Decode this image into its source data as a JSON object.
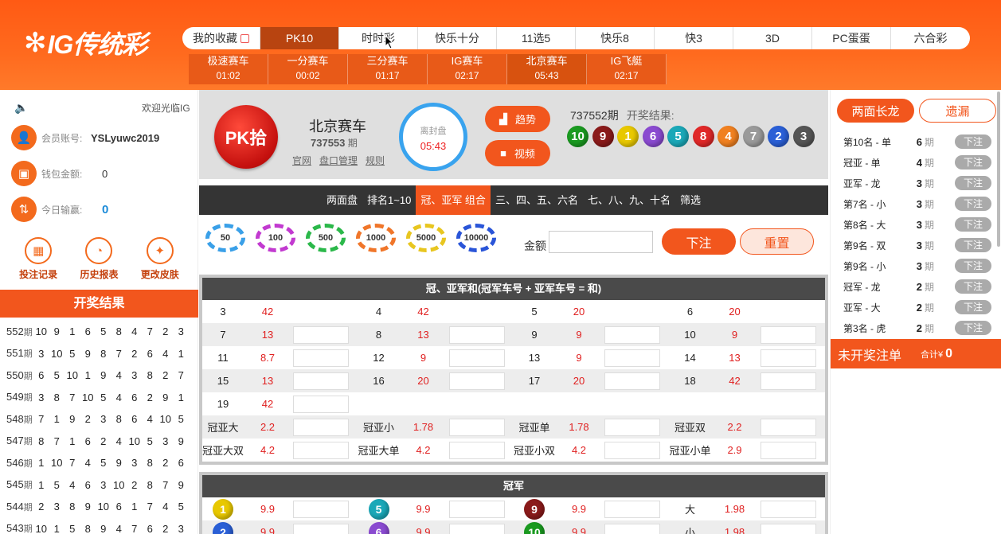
{
  "header": {
    "logo": "IG传统彩",
    "nav": [
      {
        "label": "我的收藏",
        "w": 98
      },
      {
        "label": "PK10",
        "w": 99
      },
      {
        "label": "时时彩",
        "w": 99
      },
      {
        "label": "快乐十分",
        "w": 99
      },
      {
        "label": "11选5",
        "w": 99
      },
      {
        "label": "快乐8",
        "w": 99
      },
      {
        "label": "快3",
        "w": 99
      },
      {
        "label": "3D",
        "w": 99
      },
      {
        "label": "PC蛋蛋",
        "w": 99
      },
      {
        "label": "六合彩",
        "w": 99
      }
    ],
    "active": 1,
    "subnav": [
      {
        "name": "极速赛车",
        "time": "01:02"
      },
      {
        "name": "一分赛车",
        "time": "00:02"
      },
      {
        "name": "三分赛车",
        "time": "01:17"
      },
      {
        "name": "IG赛车",
        "time": "02:17"
      },
      {
        "name": "北京赛车",
        "time": "05:43"
      },
      {
        "name": "IG飞艇",
        "time": "02:17"
      }
    ],
    "sub_active": 4
  },
  "user": {
    "welcome": "欢迎光临IG",
    "account_label": "会员账号:",
    "account": "YSLyuwc2019",
    "balance_label": "钱包金额:",
    "balance": "0",
    "profit_label": "今日输赢:",
    "profit": "0",
    "tools": [
      "投注记录",
      "历史报表",
      "更改皮肤"
    ]
  },
  "history": {
    "title": "开奖结果",
    "unit": "期",
    "rows": [
      {
        "p": "552",
        "n": [
          10,
          9,
          1,
          6,
          5,
          8,
          4,
          7,
          2,
          3
        ]
      },
      {
        "p": "551",
        "n": [
          3,
          10,
          5,
          9,
          8,
          7,
          2,
          6,
          4,
          1
        ]
      },
      {
        "p": "550",
        "n": [
          6,
          5,
          10,
          1,
          9,
          4,
          3,
          8,
          2,
          7
        ]
      },
      {
        "p": "549",
        "n": [
          3,
          8,
          7,
          10,
          5,
          4,
          6,
          2,
          9,
          1
        ]
      },
      {
        "p": "548",
        "n": [
          7,
          1,
          9,
          2,
          3,
          8,
          6,
          4,
          10,
          5
        ]
      },
      {
        "p": "547",
        "n": [
          8,
          7,
          1,
          6,
          2,
          4,
          10,
          5,
          3,
          9
        ]
      },
      {
        "p": "546",
        "n": [
          1,
          10,
          7,
          4,
          5,
          9,
          3,
          8,
          2,
          6
        ]
      },
      {
        "p": "545",
        "n": [
          1,
          5,
          4,
          6,
          3,
          10,
          2,
          8,
          7,
          9
        ]
      },
      {
        "p": "544",
        "n": [
          2,
          3,
          8,
          9,
          10,
          6,
          1,
          7,
          4,
          5
        ]
      },
      {
        "p": "543",
        "n": [
          10,
          1,
          5,
          8,
          9,
          4,
          7,
          6,
          2,
          3
        ]
      }
    ]
  },
  "game": {
    "badge": "PK拾",
    "name": "北京赛车",
    "issue": "737553",
    "issue_unit": "期",
    "links": [
      "官网",
      "盘口管理",
      "规则"
    ],
    "timer_label": "离封盘",
    "timer": "05:43",
    "trend": "趋势",
    "video": "视频",
    "last_issue": "737552期",
    "last_label": "开奖结果:",
    "last_balls": [
      10,
      9,
      1,
      6,
      5,
      8,
      4,
      7,
      2,
      3
    ]
  },
  "tabs": [
    "两面盘",
    "排名1~10",
    "冠、亚军 组合",
    "三、四、五、六名",
    "七、八、九、十名",
    "筛选"
  ],
  "tab_active": 2,
  "chips": [
    {
      "v": "50",
      "c": "#3aa0e8"
    },
    {
      "v": "100",
      "c": "#c23ad0"
    },
    {
      "v": "500",
      "c": "#2bb84a"
    },
    {
      "v": "1000",
      "c": "#f0762a"
    },
    {
      "v": "5000",
      "c": "#e8c620"
    },
    {
      "v": "10000",
      "c": "#2a55d8"
    }
  ],
  "amount_label": "金额",
  "bet_label": "下注",
  "reset_label": "重置",
  "sum": {
    "title": "冠、亚军和(冠军车号 + 亚军车号 = 和)",
    "rows": [
      [
        [
          "3",
          "42"
        ],
        [
          "4",
          "42"
        ],
        [
          "5",
          "20"
        ],
        [
          "6",
          "20"
        ]
      ],
      [
        [
          "7",
          "13"
        ],
        [
          "8",
          "13"
        ],
        [
          "9",
          "9"
        ],
        [
          "10",
          "9"
        ]
      ],
      [
        [
          "11",
          "8.7"
        ],
        [
          "12",
          "9"
        ],
        [
          "13",
          "9"
        ],
        [
          "14",
          "13"
        ]
      ],
      [
        [
          "15",
          "13"
        ],
        [
          "16",
          "20"
        ],
        [
          "17",
          "20"
        ],
        [
          "18",
          "42"
        ]
      ],
      [
        [
          "19",
          "42"
        ]
      ],
      [
        [
          "冠亚大",
          "2.2"
        ],
        [
          "冠亚小",
          "1.78"
        ],
        [
          "冠亚单",
          "1.78"
        ],
        [
          "冠亚双",
          "2.2"
        ]
      ],
      [
        [
          "冠亚大双",
          "4.2"
        ],
        [
          "冠亚大单",
          "4.2"
        ],
        [
          "冠亚小双",
          "4.2"
        ],
        [
          "冠亚小单",
          "2.9"
        ]
      ]
    ]
  },
  "champ": {
    "title": "冠军",
    "rows": [
      [
        [
          "1",
          "9.9"
        ],
        [
          "5",
          "9.9"
        ],
        [
          "9",
          "9.9"
        ],
        [
          "大",
          "1.98"
        ]
      ],
      [
        [
          "2",
          "9.9"
        ],
        [
          "6",
          "9.9"
        ],
        [
          "10",
          "9.9"
        ],
        [
          "小",
          "1.98"
        ]
      ]
    ]
  },
  "ball_colors": {
    "1": "#e8c800",
    "2": "#2a5fd6",
    "3": "#555",
    "4": "#f08020",
    "5": "#1aa8b8",
    "6": "#8a4ad0",
    "7": "#9a9a9a",
    "8": "#e02828",
    "9": "#8a1a1a",
    "10": "#1a9a20"
  },
  "right": {
    "tab_a": "两面长龙",
    "tab_b": "遗漏",
    "unit": "期",
    "btn": "下注",
    "rows": [
      {
        "n": "第10名 - 单",
        "q": "6"
      },
      {
        "n": "冠亚 - 单",
        "q": "4"
      },
      {
        "n": "亚军 - 龙",
        "q": "3"
      },
      {
        "n": "第7名 - 小",
        "q": "3"
      },
      {
        "n": "第8名 - 大",
        "q": "3"
      },
      {
        "n": "第9名 - 双",
        "q": "3"
      },
      {
        "n": "第9名 - 小",
        "q": "3"
      },
      {
        "n": "冠军 - 龙",
        "q": "2"
      },
      {
        "n": "亚军 - 大",
        "q": "2"
      },
      {
        "n": "第3名 - 虎",
        "q": "2"
      }
    ],
    "unsettled": "未开奖注单",
    "total_label": "合计¥",
    "total": "0"
  }
}
